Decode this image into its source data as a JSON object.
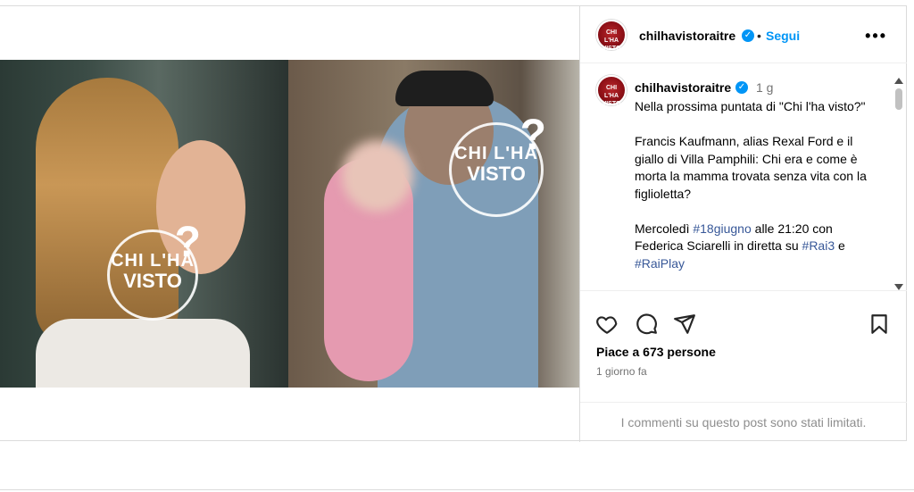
{
  "post": {
    "username": "chilhavistoraitre",
    "follow_label": "Segui",
    "dot_separator": "•",
    "more_label": "•••",
    "avatar_text": "CHI L'HA VISTO",
    "verified_mark": "✓"
  },
  "watermark": {
    "line1": "CHI L'HA",
    "line2": "VISTO",
    "mark": "?"
  },
  "caption": {
    "username": "chilhavistoraitre",
    "time": "1 g",
    "para1": "Nella prossima puntata di \"Chi l'ha visto?\"",
    "para2": "Francis Kaufmann, alias Rexal Ford e il giallo di Villa Pamphili: Chi era e come è morta la mamma trovata senza vita con la figlioletta?",
    "para3_a": "Mercoledì ",
    "para3_tag1": "#18giugno",
    "para3_b": " alle 21:20 con Federica Sciarelli in diretta su ",
    "para3_tag2": "#Rai3",
    "para3_c": " e ",
    "para3_tag3": "#RaiPlay"
  },
  "actions": {
    "like_icon": "heart-icon",
    "comment_icon": "comment-icon",
    "share_icon": "paper-plane-icon",
    "save_icon": "bookmark-icon"
  },
  "likes_text": "Piace a 673 persone",
  "time_ago": "1 giorno fa",
  "comments_limited": "I commenti su questo post sono stati limitati.",
  "colors": {
    "accent": "#0095f6",
    "hashtag": "#385898",
    "muted": "#737373",
    "border": "#dbdbdb"
  }
}
